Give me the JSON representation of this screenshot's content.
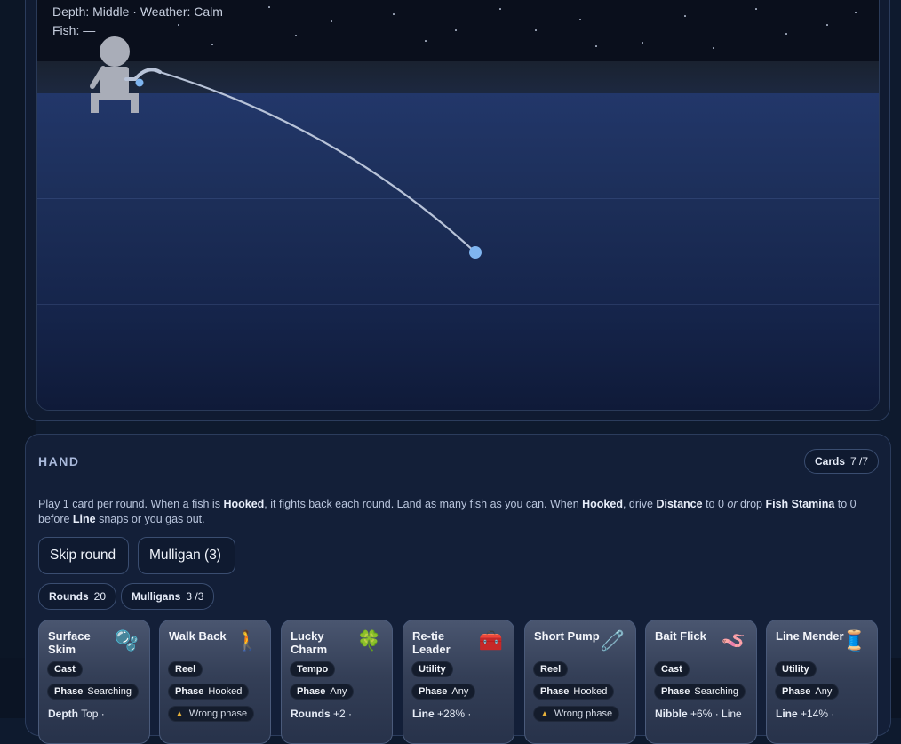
{
  "scene": {
    "depth_line": "Depth: Middle · Weather: Calm",
    "fish_line": "Fish: —"
  },
  "hand": {
    "title": "HAND",
    "cards_label": "Cards",
    "cards_count": "7",
    "cards_max": "/7",
    "help_parts": [
      "Play 1 card per round. When a fish is ",
      "Hooked",
      ", it fights back each round. Land as many fish as you can. When ",
      "Hooked",
      ", drive ",
      "Distance",
      " to 0 ",
      "or",
      " drop ",
      "Fish Stamina",
      " to 0 before ",
      "Line",
      " snaps or you gas out."
    ],
    "skip_button": "Skip round",
    "mulligan_button": "Mulligan (3)",
    "rounds_label": "Rounds",
    "rounds_value": "20",
    "mulligans_label": "Mulligans",
    "mulligans_value": "3",
    "mulligans_max": "/3"
  },
  "cards": [
    {
      "name": "Surface Skim",
      "icon": "bubbles-icon",
      "glyph": "🫧",
      "type": "Cast",
      "phase_label": "Phase",
      "phase": "Searching",
      "effect_label": "Depth",
      "effect": "Top ·"
    },
    {
      "name": "Walk Back",
      "icon": "walking-person-icon",
      "glyph": "🚶",
      "type": "Reel",
      "phase_label": "Phase",
      "phase": "Hooked",
      "warning": "Wrong phase"
    },
    {
      "name": "Lucky Charm",
      "icon": "four-leaf-clover-icon",
      "glyph": "🍀",
      "type": "Tempo",
      "phase_label": "Phase",
      "phase": "Any",
      "effect_label": "Rounds",
      "effect": "+2 ·"
    },
    {
      "name": "Re-tie Leader",
      "icon": "toolbox-icon",
      "glyph": "🧰",
      "type": "Utility",
      "phase_label": "Phase",
      "phase": "Any",
      "effect_label": "Line",
      "effect": "+28% ·"
    },
    {
      "name": "Short Pump",
      "icon": "safety-pin-icon",
      "glyph": "🧷",
      "type": "Reel",
      "phase_label": "Phase",
      "phase": "Hooked",
      "warning": "Wrong phase"
    },
    {
      "name": "Bait Flick",
      "icon": "worm-icon",
      "glyph": "🪱",
      "type": "Cast",
      "phase_label": "Phase",
      "phase": "Searching",
      "effect_label": "Nibble",
      "effect": "+6% · Line"
    },
    {
      "name": "Line Mender",
      "icon": "thread-spool-icon",
      "glyph": "🧵",
      "type": "Utility",
      "phase_label": "Phase",
      "phase": "Any",
      "effect_label": "Line",
      "effect": "+14% ·"
    }
  ],
  "colors": {
    "line": "#b8c3d8",
    "bobber": "#7fb5f0",
    "angler": "#a9adb8"
  }
}
